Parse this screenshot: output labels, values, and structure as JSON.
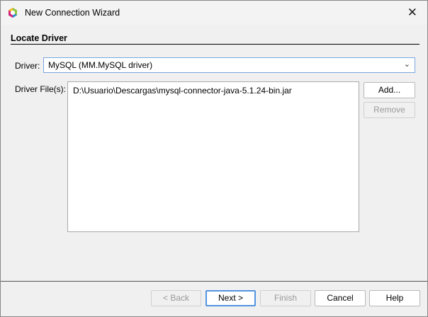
{
  "window": {
    "title": "New Connection Wizard",
    "logo_icon": "netbeans-logo-icon",
    "close_icon": "close-icon"
  },
  "section": {
    "title": "Locate Driver"
  },
  "driver": {
    "label": "Driver:",
    "value": "MySQL (MM.MySQL driver)"
  },
  "driver_files": {
    "label": "Driver File(s):",
    "items": [
      "D:\\Usuario\\Descargas\\mysql-connector-java-5.1.24-bin.jar"
    ]
  },
  "buttons": {
    "add": "Add...",
    "remove": "Remove",
    "back": "< Back",
    "next": "Next >",
    "finish": "Finish",
    "cancel": "Cancel",
    "help": "Help"
  }
}
